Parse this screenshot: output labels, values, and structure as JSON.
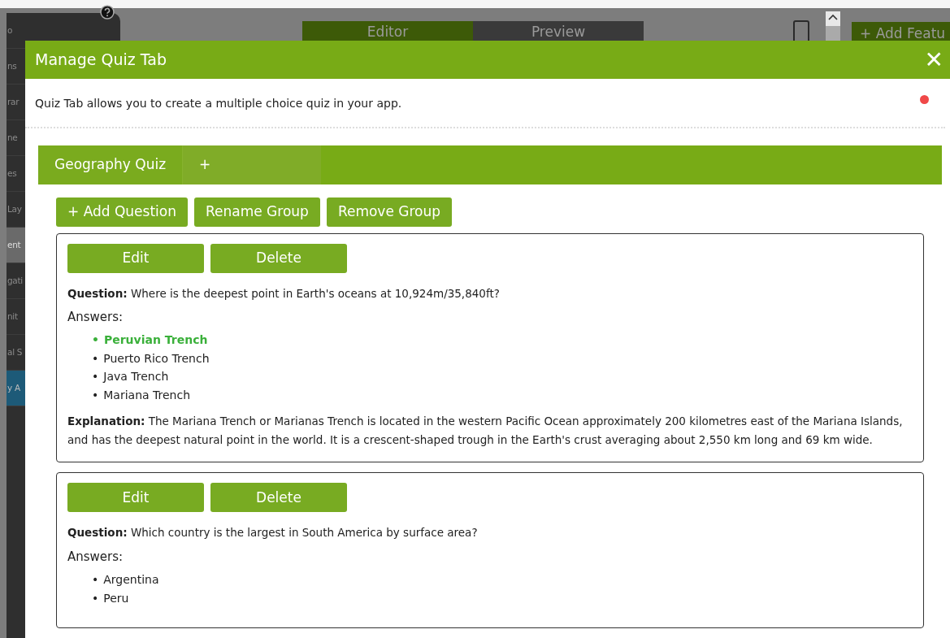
{
  "background": {
    "sidebar_items": [
      {
        "label": "o",
        "selected": false
      },
      {
        "label": "ns",
        "selected": false
      },
      {
        "label": "rar",
        "selected": false
      },
      {
        "label": "ne",
        "selected": false
      },
      {
        "label": "es",
        "selected": false
      },
      {
        "label": "Lay",
        "selected": false
      },
      {
        "label": "ent",
        "selected": true
      },
      {
        "label": "gati",
        "selected": false
      },
      {
        "label": "nit",
        "selected": false
      },
      {
        "label": "al S",
        "selected": false
      },
      {
        "label": "y A",
        "selected": false
      }
    ],
    "view_tabs": [
      {
        "label": "Editor",
        "selected": true
      },
      {
        "label": "Preview",
        "selected": false
      }
    ],
    "add_feature_button": "+ Add Featu"
  },
  "dialog": {
    "title": "Manage Quiz Tab",
    "close": "✕",
    "description": "Quiz Tab allows you to create a multiple choice quiz in your app.",
    "group_tabs": [
      {
        "label": "Geography Quiz",
        "selected": true
      },
      {
        "label": "+",
        "selected": false
      }
    ],
    "group_buttons": [
      "+ Add Question",
      "Rename Group",
      "Remove Group"
    ],
    "questions": [
      {
        "buttons": [
          "Edit",
          "Delete"
        ],
        "question": "**Question:** Where is the deepest point in Earth's oceans at 10,924m/35,840ft?",
        "answers_label": "Answers:",
        "answers": [
          {
            "bullet": "•",
            "text": "Peruvian Trench",
            "correct": true
          },
          {
            "bullet": "•",
            "text": "Puerto Rico Trench",
            "correct": false
          },
          {
            "bullet": "•",
            "text": "Java Trench",
            "correct": false
          },
          {
            "bullet": "•",
            "text": "Mariana Trench",
            "correct": false
          }
        ],
        "explanation": "**Explanation:** The Mariana Trench or Marianas Trench is located in the western Pacific Ocean approximately 200 kilometres east of the Mariana Islands, and has the deepest natural point in the world. It is a crescent-shaped trough in the Earth's crust averaging about 2,550 km long and 69 km wide."
      },
      {
        "buttons": [
          "Edit",
          "Delete"
        ],
        "question": "**Question:** Which country is the largest in South America by surface area?",
        "answers_label": "Answers:",
        "answers": [
          {
            "bullet": "•",
            "text": "Argentina",
            "correct": false
          },
          {
            "bullet": "•",
            "text": "Peru",
            "correct": false
          }
        ]
      }
    ]
  }
}
